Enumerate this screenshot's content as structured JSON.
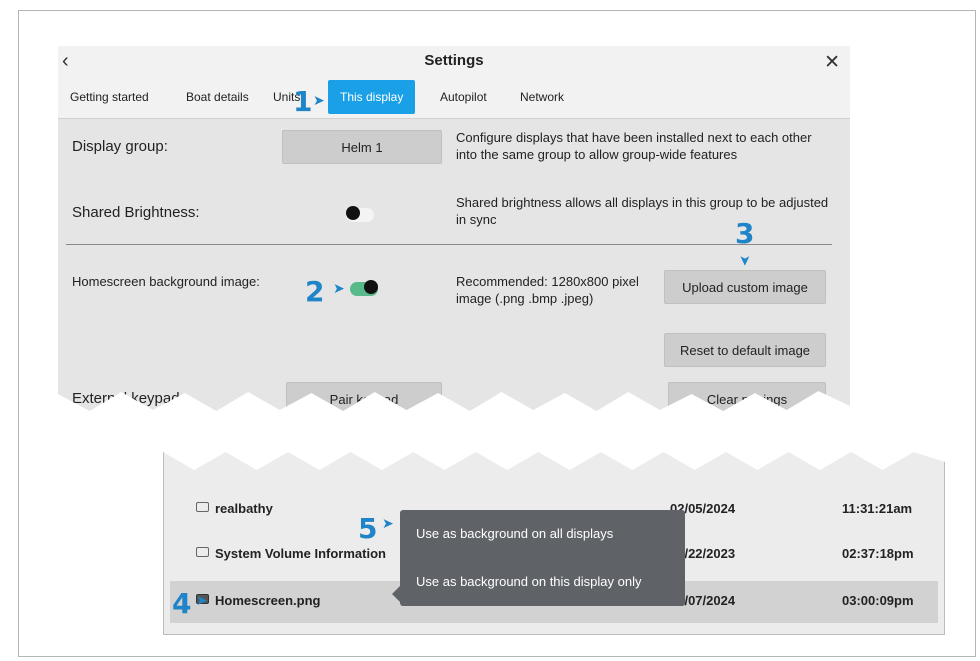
{
  "settings": {
    "title": "Settings",
    "back_icon": "chevron-left-icon",
    "close_icon": "close-icon",
    "tabs": [
      {
        "label": "Getting started"
      },
      {
        "label": "Boat details"
      },
      {
        "label": "Units"
      },
      {
        "label": "This display",
        "active": true
      },
      {
        "label": "Autopilot"
      },
      {
        "label": "Network"
      }
    ],
    "display_group": {
      "label": "Display group:",
      "button": "Helm 1",
      "description": "Configure displays that have been installed next to each other into the same group to allow group-wide features"
    },
    "shared_brightness": {
      "label": "Shared Brightness:",
      "enabled": false,
      "description": "Shared brightness allows all displays in this group to be adjusted in sync"
    },
    "homescreen_background": {
      "label": "Homescreen background image:",
      "enabled": true,
      "recommendation": "Recommended: 1280x800 pixel image (.png .bmp .jpeg)",
      "upload_button": "Upload custom image",
      "reset_button": "Reset to default image"
    },
    "external_keypad": {
      "label": "External keypad:",
      "button": "Pair keypad",
      "right_button": "Clear pairings"
    }
  },
  "file_list": {
    "rows": [
      {
        "name": "realbathy",
        "type": "folder",
        "date": "02/05/2024",
        "time": "11:31:21am"
      },
      {
        "name": "System Volume Information",
        "type": "folder",
        "date": "08/22/2023",
        "time": "02:37:18pm"
      },
      {
        "name": "Homescreen.png",
        "type": "image",
        "date": "06/07/2024",
        "time": "03:00:09pm",
        "selected": true
      }
    ]
  },
  "context_menu": {
    "items": [
      "Use as background on all displays",
      "Use as background on this display only"
    ]
  },
  "callouts": [
    "1",
    "2",
    "3",
    "4",
    "5"
  ],
  "colors": {
    "accent": "#1aa0e6",
    "callout": "#1f84c8",
    "toggle_on": "#58b98a",
    "menu_bg": "#5f6368"
  }
}
